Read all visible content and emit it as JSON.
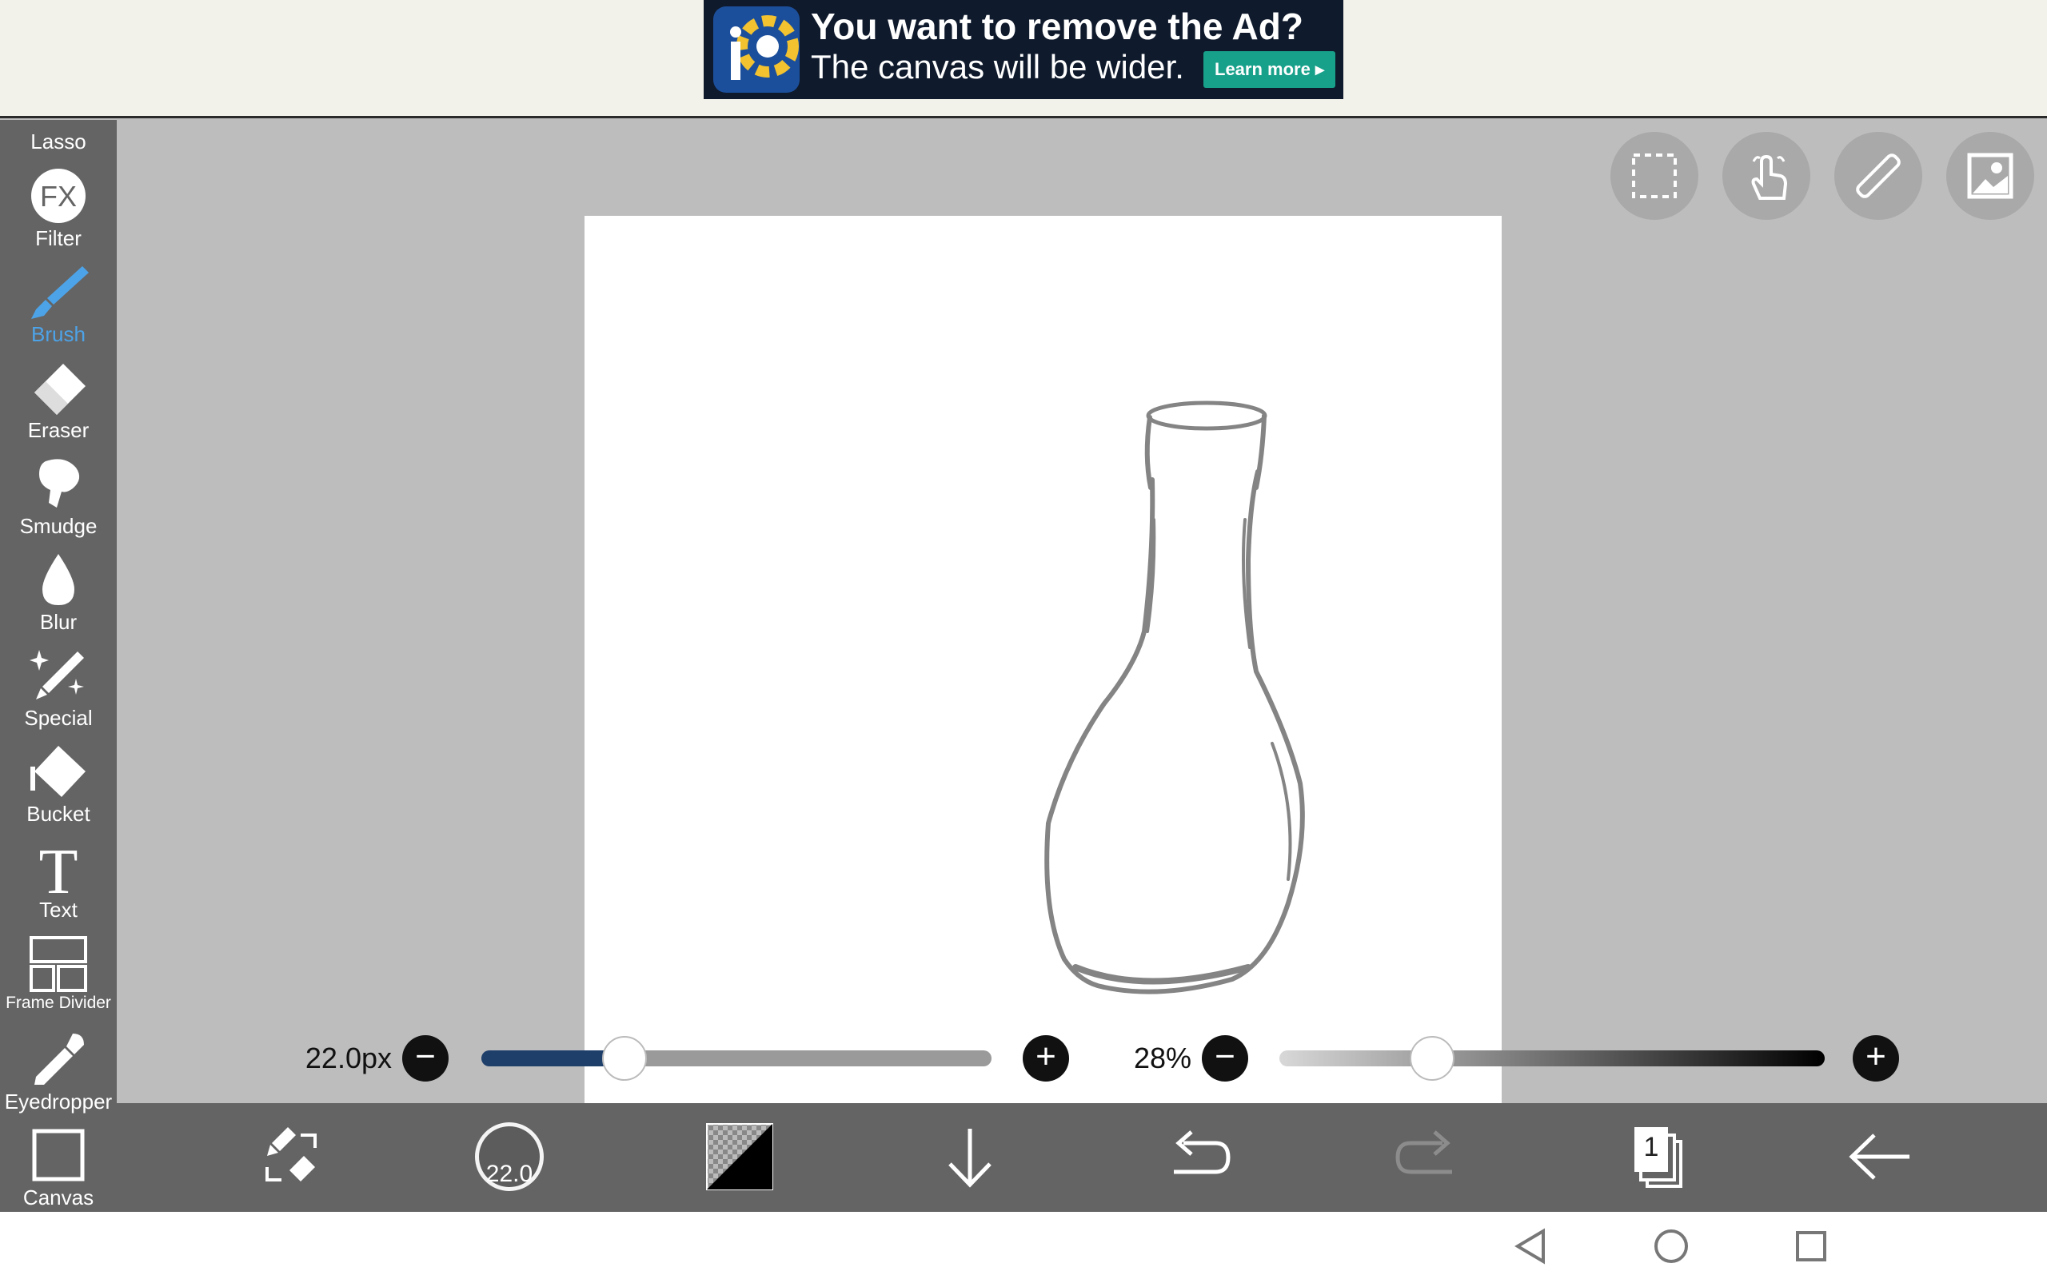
{
  "ad": {
    "title": "You want to remove the Ad?",
    "subtitle": "The canvas will be wider.",
    "button": "Learn more"
  },
  "toolbar": {
    "lasso_label": "Lasso",
    "tools": [
      {
        "label": "Filter",
        "icon": "fx-icon"
      },
      {
        "label": "Brush",
        "icon": "brush-icon",
        "active": true
      },
      {
        "label": "Eraser",
        "icon": "eraser-icon"
      },
      {
        "label": "Smudge",
        "icon": "smudge-icon"
      },
      {
        "label": "Blur",
        "icon": "blur-drop-icon"
      },
      {
        "label": "Special",
        "icon": "sparkle-pen-icon"
      },
      {
        "label": "Bucket",
        "icon": "bucket-icon"
      },
      {
        "label": "Text",
        "icon": "text-icon"
      },
      {
        "label": "Frame Divider",
        "icon": "frame-divider-icon"
      },
      {
        "label": "Eyedropper",
        "icon": "eyedropper-icon"
      },
      {
        "label": "Canvas",
        "icon": "canvas-icon"
      }
    ],
    "fx_text": "FX",
    "text_glyph": "T"
  },
  "brush": {
    "size_label": "22.0px",
    "size_fraction": 0.28,
    "opacity_label": "28%",
    "opacity_fraction": 0.28,
    "preview_label": "22.0"
  },
  "layers": {
    "count": "1"
  },
  "colors": {
    "accent": "#4da3e8",
    "slider_fill": "#1f3f6b",
    "toolbar_bg": "#646464",
    "workspace_bg": "#bdbdbd"
  }
}
